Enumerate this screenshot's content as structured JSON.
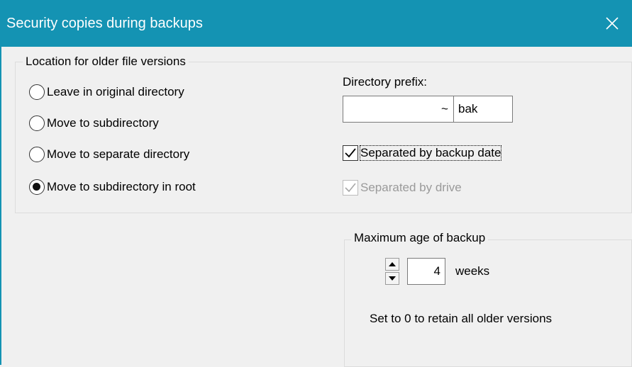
{
  "window": {
    "title": "Security copies during backups",
    "close_glyph": "✕"
  },
  "location_group": {
    "label": "Location for older file versions",
    "options": [
      {
        "label": "Leave in original directory",
        "selected": false
      },
      {
        "label": "Move to subdirectory",
        "selected": false
      },
      {
        "label": "Move to separate directory",
        "selected": false
      },
      {
        "label": "Move to subdirectory in root",
        "selected": true
      }
    ]
  },
  "directory_prefix": {
    "label": "Directory prefix:",
    "tilde": "~",
    "value": "bak"
  },
  "checkboxes": {
    "by_date": {
      "label": "Separated by backup date",
      "checked": true,
      "enabled": true
    },
    "by_drive": {
      "label": "Separated by drive",
      "checked": true,
      "enabled": false
    }
  },
  "max_age_group": {
    "label": "Maximum age of backup",
    "value": "4",
    "unit": "weeks",
    "hint": "Set to 0 to retain all older versions"
  },
  "colors": {
    "titlebar": "#1493b3",
    "background": "#f0f0f0"
  }
}
